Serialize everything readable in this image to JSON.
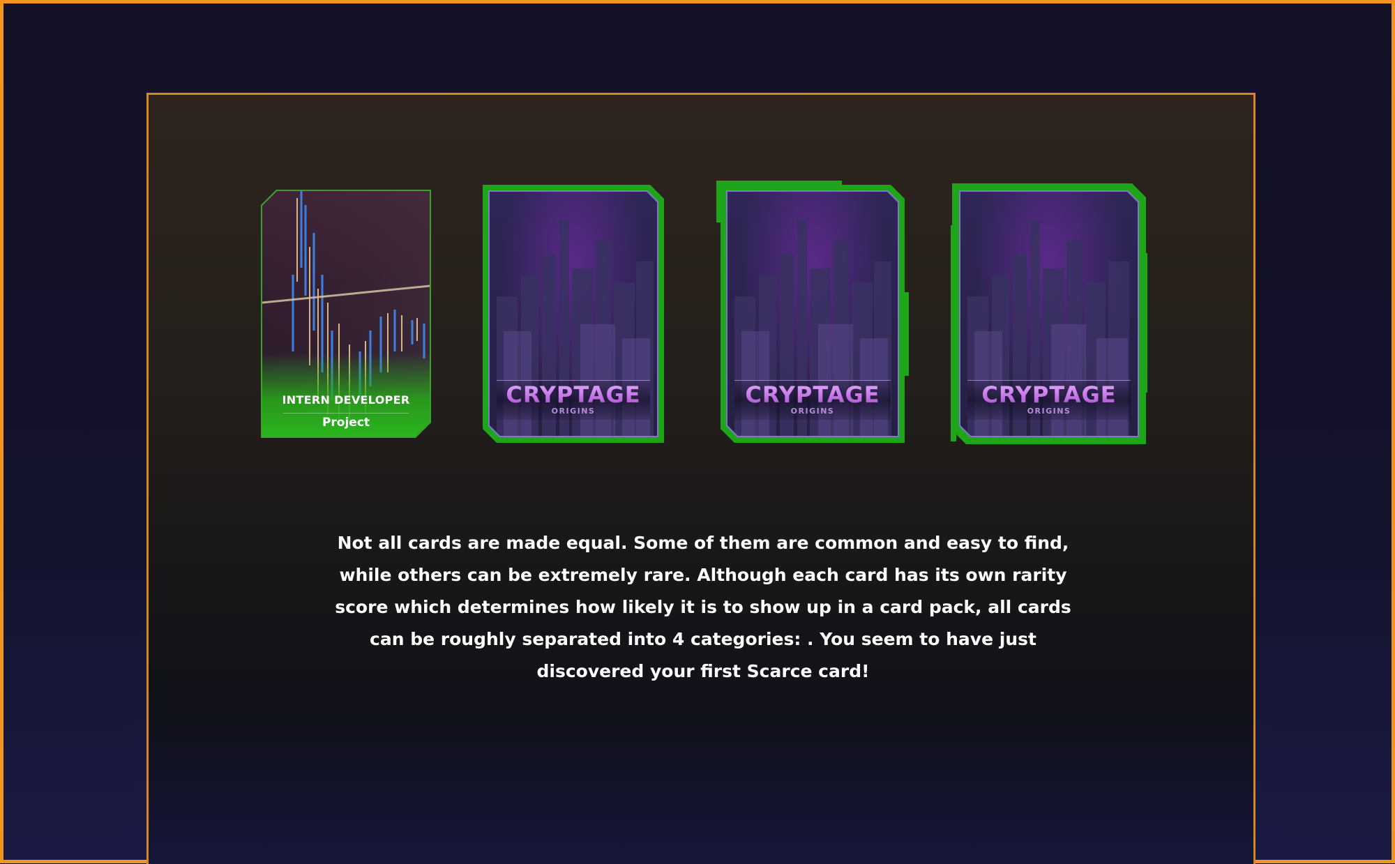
{
  "colors": {
    "outer_border": "#f0961e",
    "panel_border": "#d9861c",
    "card_green": "#1fa51a",
    "logo_purple": "#c46ce6"
  },
  "cards": {
    "revealed": {
      "title": "INTERN DEVELOPER",
      "subtitle": "Project",
      "icon": "candlestick-chart-art"
    },
    "face_down": [
      {
        "logo": "CRYPTAGE",
        "logo_sub": "ORIGINS"
      },
      {
        "logo": "CRYPTAGE",
        "logo_sub": "ORIGINS"
      },
      {
        "logo": "CRYPTAGE",
        "logo_sub": "ORIGINS"
      }
    ]
  },
  "description": "Not all cards are made equal. Some of them are common and easy to find, while others can be extremely rare. Although each card has its own rarity score which determines how likely it is to show up in a card pack, all cards can be roughly separated into 4 categories:  . You seem to have just discovered your first Scarce card!"
}
